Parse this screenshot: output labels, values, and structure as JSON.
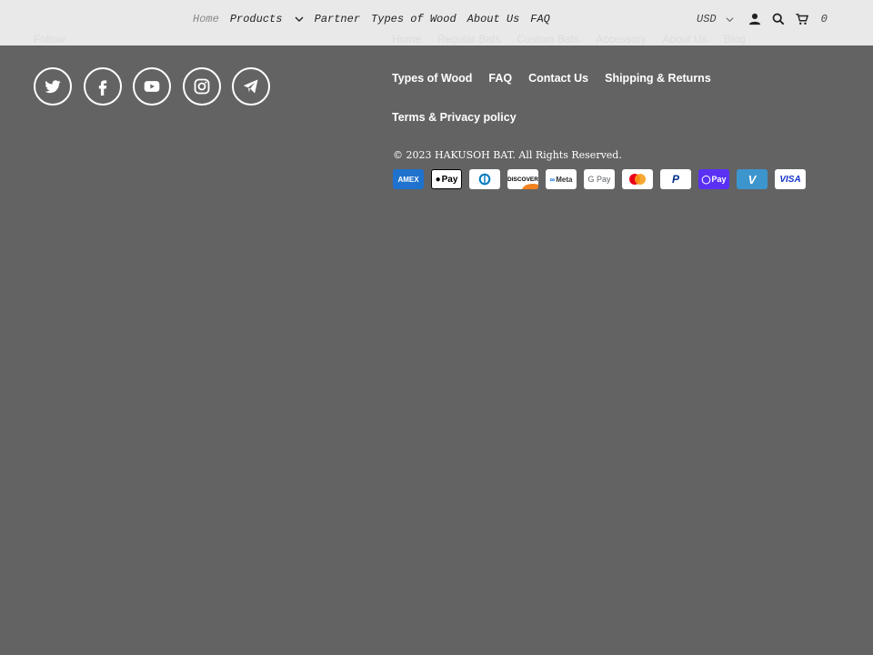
{
  "nav": {
    "items": [
      "Home",
      "Products",
      "Partner",
      "Types of Wood",
      "About Us",
      "FAQ"
    ]
  },
  "tools": {
    "currency": "USD",
    "cart_count": "0"
  },
  "footer": {
    "follow_label": "Follow",
    "top_links": [
      "Home",
      "Regular Bats",
      "Custom Bats",
      "Accessory",
      "About Us",
      "Blog"
    ],
    "links": [
      "Types of Wood",
      "FAQ",
      "Contact Us",
      "Shipping & Returns"
    ],
    "policy_link": "Terms & Privacy policy",
    "copyright": "© 2023 HAKUSOH BAT. All Rights Reserved.",
    "payments": [
      "AMEX",
      "Pay",
      "D",
      "DISCOVER",
      "Meta",
      "G Pay",
      "MC",
      "P",
      "Pay",
      "V",
      "VISA"
    ],
    "social_icons": [
      "twitter-icon",
      "facebook-icon",
      "youtube-icon",
      "instagram-icon",
      "telegram-icon"
    ]
  },
  "colors": {
    "background": "#636363",
    "header": "#e9e9e9",
    "amex": "#1f72cd",
    "shop_pay": "#5a31f4",
    "venmo": "#3d95ce",
    "visa": "#1434cb"
  }
}
